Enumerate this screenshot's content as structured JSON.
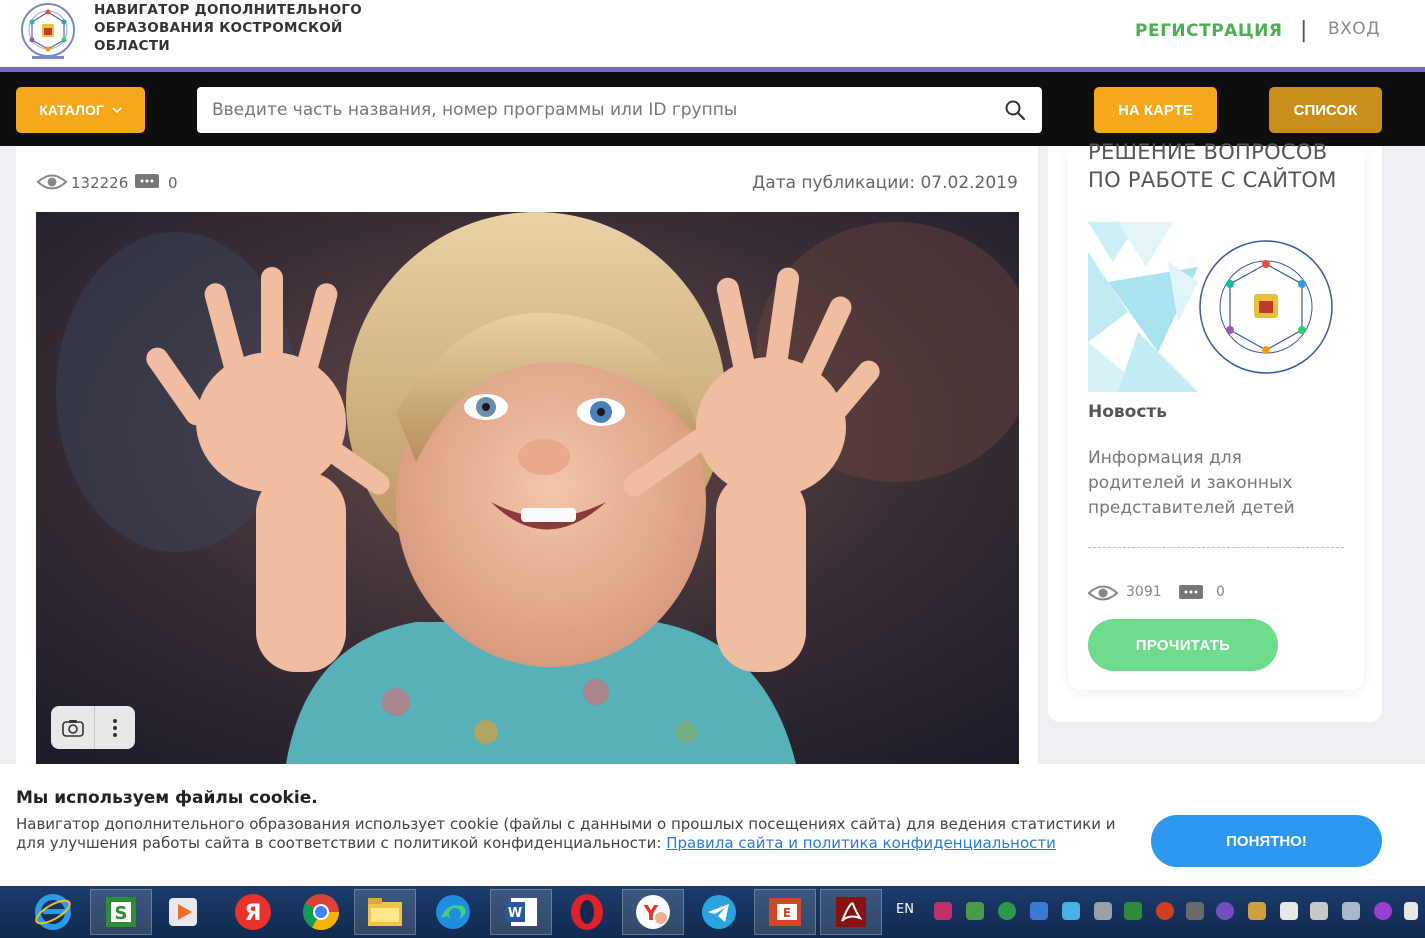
{
  "header": {
    "site_title": "НАВИГАТОР ДОПОЛНИТЕЛЬНОГО ОБРАЗОВАНИЯ КОСТРОМСКОЙ ОБЛАСТИ",
    "register_label": "РЕГИСТРАЦИЯ",
    "separator": "|",
    "login_label": "ВХОД"
  },
  "toolbar": {
    "catalog_label": "КАТАЛОГ",
    "search_placeholder": "Введите часть названия, номер программы или ID группы",
    "map_label": "НА КАРТЕ",
    "list_label": "СПИСОК"
  },
  "article": {
    "views": "132226",
    "comments": "0",
    "publication_date": "Дата публикации: 07.02.2019"
  },
  "sidebar_card": {
    "title": "РЕШЕНИЕ ВОПРОСОВ ПО РАБОТЕ С САЙТОМ",
    "type": "Новость",
    "description": "Информация для родителей и законных представителей детей",
    "views": "3091",
    "comments": "0",
    "read_label": "ПРОЧИТАТЬ"
  },
  "cookie": {
    "title": "Мы используем файлы cookie.",
    "text": "Навигатор дополнительного образования использует cookie (файлы с данными о прошлых посещениях сайта) для ведения статистики и для улучшения работы сайта в соответствии с политикой конфиденциальности: ",
    "link_text": "Правила сайта и политика конфиденциальности",
    "ok_label": "ПОНЯТНО!"
  },
  "taskbar": {
    "language": "EN"
  },
  "colors": {
    "accent_orange": "#f3a81e",
    "header_line": "#6f6bc4",
    "register_green": "#4caf50",
    "read_button": "#6edc8c",
    "ok_button": "#2e97f0"
  }
}
